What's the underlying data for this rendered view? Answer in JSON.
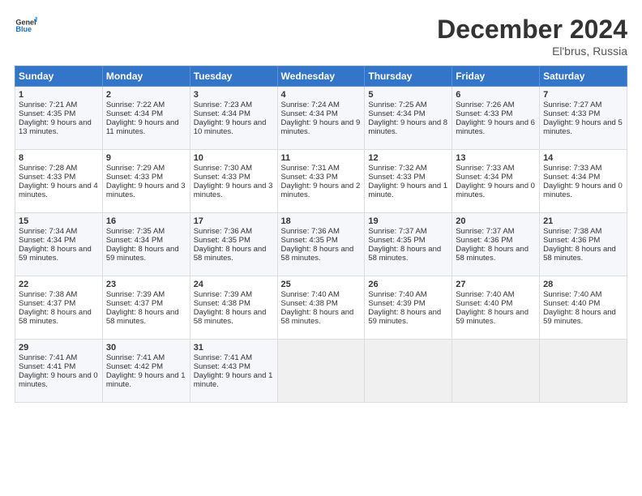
{
  "header": {
    "logo_line1": "General",
    "logo_line2": "Blue",
    "month": "December 2024",
    "location": "El'brus, Russia"
  },
  "weekdays": [
    "Sunday",
    "Monday",
    "Tuesday",
    "Wednesday",
    "Thursday",
    "Friday",
    "Saturday"
  ],
  "weeks": [
    [
      {
        "day": "1",
        "sunrise": "Sunrise: 7:21 AM",
        "sunset": "Sunset: 4:35 PM",
        "daylight": "Daylight: 9 hours and 13 minutes."
      },
      {
        "day": "2",
        "sunrise": "Sunrise: 7:22 AM",
        "sunset": "Sunset: 4:34 PM",
        "daylight": "Daylight: 9 hours and 11 minutes."
      },
      {
        "day": "3",
        "sunrise": "Sunrise: 7:23 AM",
        "sunset": "Sunset: 4:34 PM",
        "daylight": "Daylight: 9 hours and 10 minutes."
      },
      {
        "day": "4",
        "sunrise": "Sunrise: 7:24 AM",
        "sunset": "Sunset: 4:34 PM",
        "daylight": "Daylight: 9 hours and 9 minutes."
      },
      {
        "day": "5",
        "sunrise": "Sunrise: 7:25 AM",
        "sunset": "Sunset: 4:34 PM",
        "daylight": "Daylight: 9 hours and 8 minutes."
      },
      {
        "day": "6",
        "sunrise": "Sunrise: 7:26 AM",
        "sunset": "Sunset: 4:33 PM",
        "daylight": "Daylight: 9 hours and 6 minutes."
      },
      {
        "day": "7",
        "sunrise": "Sunrise: 7:27 AM",
        "sunset": "Sunset: 4:33 PM",
        "daylight": "Daylight: 9 hours and 5 minutes."
      }
    ],
    [
      {
        "day": "8",
        "sunrise": "Sunrise: 7:28 AM",
        "sunset": "Sunset: 4:33 PM",
        "daylight": "Daylight: 9 hours and 4 minutes."
      },
      {
        "day": "9",
        "sunrise": "Sunrise: 7:29 AM",
        "sunset": "Sunset: 4:33 PM",
        "daylight": "Daylight: 9 hours and 3 minutes."
      },
      {
        "day": "10",
        "sunrise": "Sunrise: 7:30 AM",
        "sunset": "Sunset: 4:33 PM",
        "daylight": "Daylight: 9 hours and 3 minutes."
      },
      {
        "day": "11",
        "sunrise": "Sunrise: 7:31 AM",
        "sunset": "Sunset: 4:33 PM",
        "daylight": "Daylight: 9 hours and 2 minutes."
      },
      {
        "day": "12",
        "sunrise": "Sunrise: 7:32 AM",
        "sunset": "Sunset: 4:33 PM",
        "daylight": "Daylight: 9 hours and 1 minute."
      },
      {
        "day": "13",
        "sunrise": "Sunrise: 7:33 AM",
        "sunset": "Sunset: 4:34 PM",
        "daylight": "Daylight: 9 hours and 0 minutes."
      },
      {
        "day": "14",
        "sunrise": "Sunrise: 7:33 AM",
        "sunset": "Sunset: 4:34 PM",
        "daylight": "Daylight: 9 hours and 0 minutes."
      }
    ],
    [
      {
        "day": "15",
        "sunrise": "Sunrise: 7:34 AM",
        "sunset": "Sunset: 4:34 PM",
        "daylight": "Daylight: 8 hours and 59 minutes."
      },
      {
        "day": "16",
        "sunrise": "Sunrise: 7:35 AM",
        "sunset": "Sunset: 4:34 PM",
        "daylight": "Daylight: 8 hours and 59 minutes."
      },
      {
        "day": "17",
        "sunrise": "Sunrise: 7:36 AM",
        "sunset": "Sunset: 4:35 PM",
        "daylight": "Daylight: 8 hours and 58 minutes."
      },
      {
        "day": "18",
        "sunrise": "Sunrise: 7:36 AM",
        "sunset": "Sunset: 4:35 PM",
        "daylight": "Daylight: 8 hours and 58 minutes."
      },
      {
        "day": "19",
        "sunrise": "Sunrise: 7:37 AM",
        "sunset": "Sunset: 4:35 PM",
        "daylight": "Daylight: 8 hours and 58 minutes."
      },
      {
        "day": "20",
        "sunrise": "Sunrise: 7:37 AM",
        "sunset": "Sunset: 4:36 PM",
        "daylight": "Daylight: 8 hours and 58 minutes."
      },
      {
        "day": "21",
        "sunrise": "Sunrise: 7:38 AM",
        "sunset": "Sunset: 4:36 PM",
        "daylight": "Daylight: 8 hours and 58 minutes."
      }
    ],
    [
      {
        "day": "22",
        "sunrise": "Sunrise: 7:38 AM",
        "sunset": "Sunset: 4:37 PM",
        "daylight": "Daylight: 8 hours and 58 minutes."
      },
      {
        "day": "23",
        "sunrise": "Sunrise: 7:39 AM",
        "sunset": "Sunset: 4:37 PM",
        "daylight": "Daylight: 8 hours and 58 minutes."
      },
      {
        "day": "24",
        "sunrise": "Sunrise: 7:39 AM",
        "sunset": "Sunset: 4:38 PM",
        "daylight": "Daylight: 8 hours and 58 minutes."
      },
      {
        "day": "25",
        "sunrise": "Sunrise: 7:40 AM",
        "sunset": "Sunset: 4:38 PM",
        "daylight": "Daylight: 8 hours and 58 minutes."
      },
      {
        "day": "26",
        "sunrise": "Sunrise: 7:40 AM",
        "sunset": "Sunset: 4:39 PM",
        "daylight": "Daylight: 8 hours and 59 minutes."
      },
      {
        "day": "27",
        "sunrise": "Sunrise: 7:40 AM",
        "sunset": "Sunset: 4:40 PM",
        "daylight": "Daylight: 8 hours and 59 minutes."
      },
      {
        "day": "28",
        "sunrise": "Sunrise: 7:40 AM",
        "sunset": "Sunset: 4:40 PM",
        "daylight": "Daylight: 8 hours and 59 minutes."
      }
    ],
    [
      {
        "day": "29",
        "sunrise": "Sunrise: 7:41 AM",
        "sunset": "Sunset: 4:41 PM",
        "daylight": "Daylight: 9 hours and 0 minutes."
      },
      {
        "day": "30",
        "sunrise": "Sunrise: 7:41 AM",
        "sunset": "Sunset: 4:42 PM",
        "daylight": "Daylight: 9 hours and 1 minute."
      },
      {
        "day": "31",
        "sunrise": "Sunrise: 7:41 AM",
        "sunset": "Sunset: 4:43 PM",
        "daylight": "Daylight: 9 hours and 1 minute."
      },
      null,
      null,
      null,
      null
    ]
  ]
}
